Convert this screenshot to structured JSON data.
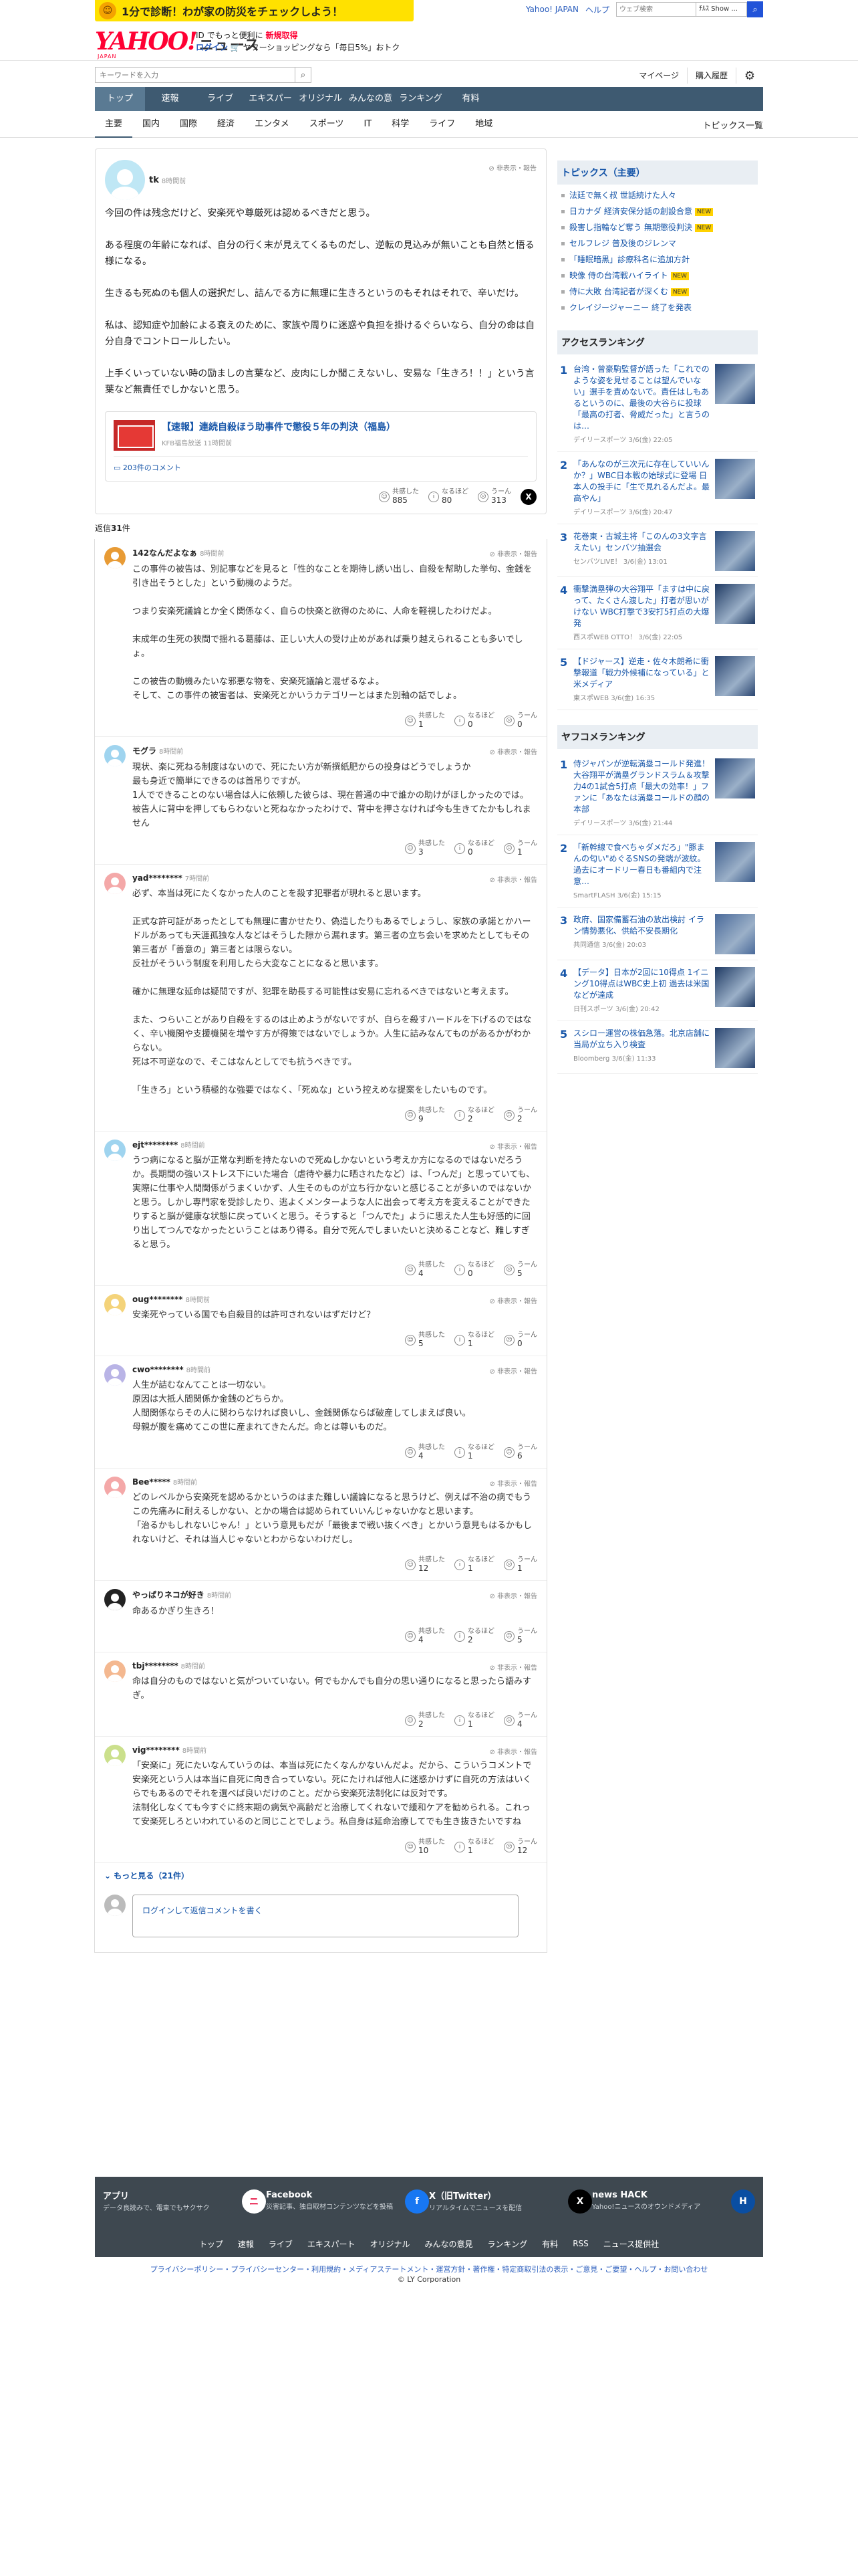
{
  "promo": {
    "text": "1分で診断！わが家の防災をチェックしよう！"
  },
  "toplinks": {
    "yahoo_japan": "Yahoo! JAPAN",
    "help": "ヘルプ",
    "search_placeholder": "ウェブ検索",
    "scope": "ﾁﾙｽ Show ..."
  },
  "logo": {
    "y": "YAHOO!",
    "jp": "JAPAN",
    "news": "ニュース"
  },
  "header_ad": {
    "l1_pre": "ID でもっと便利に",
    "l1_link": "新規取得",
    "login": "ログイン",
    "l2_rest": "ヤフーショッピングなら「毎日5%」おトク"
  },
  "search": {
    "placeholder": "キーワードを入力"
  },
  "account": {
    "mypage": "マイページ",
    "history": "購入履歴"
  },
  "gnav": [
    "トップ",
    "速報",
    "ライブ",
    "エキスパート",
    "オリジナル",
    "みんなの意見",
    "ランキング",
    "有料"
  ],
  "cnav": [
    "主要",
    "国内",
    "国際",
    "経済",
    "エンタメ",
    "スポーツ",
    "IT",
    "科学",
    "ライフ",
    "地域"
  ],
  "cnav_right": "トピックス一覧",
  "post": {
    "name": "tk",
    "time": "8時間前",
    "report": "非表示・報告",
    "paragraphs": [
      "今回の件は残念だけど、安楽死や尊厳死は認めるべきだと思う。",
      "ある程度の年齢になれば、自分の行く末が見えてくるものだし、逆転の見込みが無いことも自然と悟る様になる。",
      "生きるも死ぬのも個人の選択だし、詰んでる方に無理に生きろというのもそれはそれで、辛いだけ。",
      "私は、認知症や加齢による衰えのために、家族や周りに迷惑や負担を掛けるぐらいなら、自分の命は自分自身でコントロールしたい。",
      "上手くいっていない時の励ましの言葉など、皮肉にしか聞こえないし、安易な「生きろ！！」という言葉など無責任でしかないと思う。"
    ],
    "article_title": "【速報】連続自殺ほう助事件で懲役５年の判決（福島）",
    "article_source": "KFB福島放送 11時間前",
    "comments_link": "203件のコメント",
    "reactions": {
      "r1": "共感した",
      "n1": "885",
      "r2": "なるほど",
      "n2": "80",
      "r3": "うーん",
      "n3": "313"
    }
  },
  "reply_count_label": "返信",
  "reply_count": "31",
  "reply_count_unit": "件",
  "replies": [
    {
      "name": "142なんだよなぁ",
      "time": "8時間前",
      "color": "#e89b35",
      "p": [
        "この事件の被告は、別記事などを見ると「性的なことを期待し誘い出し、自殺を幇助した挙句、金銭を引き出そうとした」という動機のようだ。",
        "つまり安楽死議論とか全く関係なく、自らの快楽と欲得のために、人命を軽視したわけだよ。",
        "末成年の生死の狭間で揺れる葛藤は、正しい大人の受け止めがあれば乗り越えられることも多いでしょ。",
        "この被告の動機みたいな邪悪な物を、安楽死議論と混ぜるなよ。\nそして、この事件の被害者は、安楽死とかいうカテゴリーとはまた別軸の話でしょ。"
      ],
      "a": "1",
      "b": "0",
      "c": "0"
    },
    {
      "name": "モグラ",
      "time": "8時間前",
      "color": "#9fd4ef",
      "p": [
        "現状、楽に死ねる制度はないので、死にたい方が新撰紙肥からの投身はどうでしょうか\n最も身近で簡単にできるのは首吊りですが。\n1人でできることのない場合は人に依頼した彼らは、現在普通の中で誰かの助けがほしかったのでは。\n被告人に背中を押してもらわないと死ねなかったわけで、背中を押さなければ今も生きてたかもしれません"
      ],
      "a": "3",
      "b": "0",
      "c": "1"
    },
    {
      "name": "yad********",
      "time": "7時間前",
      "color": "#f4a8a8",
      "p": [
        "必ず、本当は死にたくなかった人のことを殺す犯罪者が現れると思います。",
        "正式な許可証があったとしても無理に書かせたり、偽造したりもあるでしょうし、家族の承諾とかハードルがあっても天涯孤独な人などはそうした隙から漏れます。第三者の立ち会いを求めたとしてもその第三者が「善意の」第三者とは限らない。\n反社がそういう制度を利用したら大変なことになると思います。",
        "確かに無理な延命は疑問ですが、犯罪を助長する可能性は安易に忘れるべきではないと考えます。",
        "また、つらいことがあり自殺をするのは止めようがないですが、自らを殺すハードルを下げるのではなく、辛い機関や支援機関を増やす方が得策ではないでしょうか。人生に詰みなんてものがあるかがわからない。\n死は不可逆なので、そこはなんとしてでも抗うべきです。",
        "「生きろ」という積極的な強要ではなく、「死ぬな」という控えめな提案をしたいものです。"
      ],
      "a": "9",
      "b": "2",
      "c": "2"
    },
    {
      "name": "ejt********",
      "time": "8時間前",
      "color": "#9fd4ef",
      "p": [
        "うつ病になると脳が正常な判断を持たないので死ぬしかないという考えか方になるのではないだろうか。長期間の強いストレス下にいた場合（虐待や暴力に晒されたなど）は、「つんだ」と思っていても、実際に仕事や人間関係がうまくいかず、人生そのものが立ち行かないと感じることが多いのではないかと思う。しかし専門家を受診したり、逃よくメンターような人に出会って考え方を変えることができたりすると脳が健康な状態に戻っていくと思う。そうすると「つんでた」ように思えた人生も好感的に回り出してつんでなかったということはあり得る。自分で死んでしまいたいと決めることなど、難しすぎると思う。"
      ],
      "a": "4",
      "b": "0",
      "c": "5"
    },
    {
      "name": "oug********",
      "time": "8時間前",
      "color": "#f4d37a",
      "p": [
        "安楽死やっている国でも自殺目的は許可されないはずだけど？"
      ],
      "a": "5",
      "b": "1",
      "c": "0"
    },
    {
      "name": "cwo********",
      "time": "8時間前",
      "color": "#b9b4e6",
      "p": [
        "人生が詰むなんてことは一切ない。\n原因は大抵人間関係か金銭のどちらか。\n人間関係ならその人に関わらなければ良いし、金銭関係ならば破産してしまえば良い。\n母親が腹を痛めてこの世に産まれてきたんだ。命とは尊いものだ。"
      ],
      "a": "4",
      "b": "1",
      "c": "6"
    },
    {
      "name": "Bee*****",
      "time": "8時間前",
      "color": "#f4a8a8",
      "p": [
        "どのレベルから安楽死を認めるかというのはまた難しい議論になると思うけど、例えば不治の病でもうこの先痛みに耐えるしかない、とかの場合は認められていいんじゃないかなと思います。\n「治るかもしれないじゃん！」という意見もだが「最後まで戦い抜くべき」とかいう意見もはるかもしれないけど、それは当人じゃないとわからないわけだし。"
      ],
      "a": "12",
      "b": "1",
      "c": "1"
    },
    {
      "name": "やっぱりネコが好き",
      "time": "8時間前",
      "color": "#222",
      "p": [
        "命あるかぎり生きろ！"
      ],
      "a": "4",
      "b": "2",
      "c": "5"
    },
    {
      "name": "tbj********",
      "time": "8時間前",
      "color": "#f4b890",
      "p": [
        "命は自分のものではないと気がついていない。何でもかんでも自分の思い通りになると思ったら語みすぎ。"
      ],
      "a": "2",
      "b": "1",
      "c": "4"
    },
    {
      "name": "vig********",
      "time": "8時間前",
      "color": "#cbe08c",
      "p": [
        "「安楽に」死にたいなんていうのは、本当は死にたくなんかないんだよ。だから、こういうコメントで安楽死という人は本当に自死に向き合っていない。死にたければ他人に迷惑かけずに自死の方法はいくらでもあるのでそれを選べば良いだけのこと。だから安楽死法制化には反対です。\n法制化しなくても今すぐに終末期の病気や高齢だと治療してくれないで緩和ケアを勧められる。これって安楽死しろといわれているのと同じことでしょう。私自身は延命治療してでも生き抜きたいですね"
      ],
      "a": "10",
      "b": "1",
      "c": "12"
    }
  ],
  "reply_labels": {
    "a": "共感した",
    "b": "なるほど",
    "c": "うーん",
    "report": "非表示・報告"
  },
  "more_label": "もっと見る（21件）",
  "reply_box": "ログインして返信コメントを書く",
  "topics": {
    "title": "トピックス（主要）",
    "items": [
      {
        "t": "法廷で無く叔 世話続けた人々",
        "tag": ""
      },
      {
        "t": "日カナダ 経済安保分話の創設合意",
        "tag": "NEW"
      },
      {
        "t": "殺害し指輪など奪う 無期懲役判決",
        "tag": "NEW"
      },
      {
        "t": "セルフレジ 普及後のジレンマ",
        "tag": ""
      },
      {
        "t": "「睡眠暗黒」診療科名に追加方針",
        "tag": ""
      },
      {
        "t": "映像 侍の台湾戦ハイライト",
        "tag": "NEW"
      },
      {
        "t": "侍に大敗 台湾記者が深くむ",
        "tag": "NEW"
      },
      {
        "t": "クレイジージャーニー 終了を発表",
        "tag": ""
      }
    ]
  },
  "access": {
    "title": "アクセスランキング",
    "items": [
      {
        "no": "1",
        "t": "台湾・曾豪駒監督が語った「これでのような姿を見せることは望んでいない」選手を責めないで。責任はしもあるというのに、最後の大谷らに投球「最高の打者、脅威だった」と言うのは…",
        "m": "デイリースポーツ 3/6(金) 22:05",
        "c": "#2b4a7a"
      },
      {
        "no": "2",
        "t": "「あんなのが三次元に存在していいんか？」WBC日本戦の始球式に登場 日本人の投手に「生で見れるんだよ。最高やん」",
        "m": "デイリースポーツ 3/6(金) 20:47",
        "c": "#3a5a8a"
      },
      {
        "no": "3",
        "t": "花巻東・古城主将「このんの3文字言えたい」センバツ抽選会",
        "m": "センバツLIVE！ 3/6(金) 13:01",
        "c": "#2e4f7e"
      },
      {
        "no": "4",
        "t": "衝撃満塁弾の大谷翔平「ますは中に戻って、たくさん渡した」打者が思いがけない WBC打撃で3安打5打点の大爆発",
        "m": "西スポWEB OTTO！ 3/6(金) 22:05",
        "c": "#1f3a63"
      },
      {
        "no": "5",
        "t": "【ドジャース】逆走・佐々木朗希に衝撃報道「戦力外候補になっている」と米メディア",
        "m": "東スポWEB 3/6(金) 16:35",
        "c": "#2a4570"
      }
    ]
  },
  "yafoo": {
    "title": "ヤフコメランキング",
    "items": [
      {
        "no": "1",
        "t": "侍ジャパンが逆転満塁コールド発進！大谷翔平が満塁グランドスラム＆攻撃力4の1試合5打点「最大の効率！」ファンに「あなたは満塁コールドの顔の本部",
        "m": "デイリースポーツ 3/6(金) 21:44",
        "c": "#2b4a7a"
      },
      {
        "no": "2",
        "t": "「新幹線で食べちゃダメだろ」\"豚まんの匂い\"めぐるSNSの発端が波紋。過去にオードリー春日も番組内で注意…",
        "m": "SmartFLASH 3/6(金) 15:15",
        "c": "#3a5a8a"
      },
      {
        "no": "3",
        "t": "政府、国家備蓄石油の放出検討 イラン情勢悪化、供給不安長期化",
        "m": "共同通信 3/6(金) 20:03",
        "c": "#4a6a9a"
      },
      {
        "no": "4",
        "t": "【データ】日本が2回に10得点 1イニング10得点はWBC史上初 過去は米国などが達成",
        "m": "日刊スポーツ 3/6(金) 20:42",
        "c": "#1f3a63"
      },
      {
        "no": "5",
        "t": "スシロー運営の株価急落。北京店舗に当局が立ち入り検査",
        "m": "Bloomberg 3/6(金) 11:33",
        "c": "#2a4570"
      }
    ]
  },
  "footer": {
    "apps": [
      {
        "h": "アプリ",
        "d": "データ良読みで、電車でもサクサク",
        "ic": "ニ",
        "bg": "#fff",
        "fg": "#e60033"
      },
      {
        "h": "Facebook",
        "d": "災害記事、独自取材コンテンツなどを投稿",
        "ic": "f",
        "bg": "#1877f2",
        "fg": "#fff"
      },
      {
        "h": "X（旧Twitter）",
        "d": "リアルタイムでニュースを配信",
        "ic": "X",
        "bg": "#000",
        "fg": "#fff"
      },
      {
        "h": "news HACK",
        "d": "Yahoo!ニュースのオウンドメディア",
        "ic": "H",
        "bg": "#0a4ea2",
        "fg": "#fff"
      }
    ],
    "nav": [
      "トップ",
      "速報",
      "ライブ",
      "エキスパート",
      "オリジナル",
      "みんなの意見",
      "ランキング",
      "有料",
      "RSS",
      "ニュース提供社"
    ],
    "legal": "プライバシーポリシー・プライバシーセンター・利用規約・メディアステートメント・運営方針・著作権・特定商取引法の表示・ご意見・ご要望・ヘルプ・お問い合わせ",
    "copy": "© LY Corporation"
  },
  "colors": {
    "nav": "#3e5a71",
    "link": "#1756a9",
    "accent": "#ff0033"
  }
}
